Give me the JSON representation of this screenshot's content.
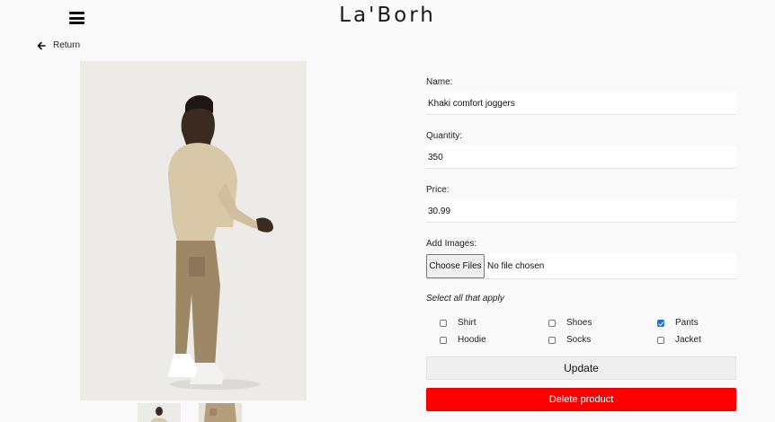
{
  "header": {
    "brand": "La'Borh",
    "menu_icon": "hamburger-menu-icon"
  },
  "nav": {
    "return_label": "Return",
    "return_icon": "arrow-left-icon"
  },
  "form": {
    "name_label": "Name:",
    "name_value": "Khaki comfort joggers",
    "quantity_label": "Quantity:",
    "quantity_value": "350",
    "price_label": "Price:",
    "price_value": "30.99",
    "images_label": "Add Images:",
    "choose_files_label": "Choose Files",
    "file_status": "No file chosen",
    "select_label": "Select all that apply",
    "categories": [
      {
        "label": "Shirt",
        "checked": false
      },
      {
        "label": "Shoes",
        "checked": false
      },
      {
        "label": "Pants",
        "checked": true
      },
      {
        "label": "Hoodie",
        "checked": false
      },
      {
        "label": "Socks",
        "checked": false
      },
      {
        "label": "Jacket",
        "checked": false
      }
    ],
    "update_label": "Update",
    "delete_label": "Delete product"
  },
  "colors": {
    "delete": "#ff0000",
    "checkbox_checked": "#1f6fd8",
    "background": "#f9f9f9"
  }
}
